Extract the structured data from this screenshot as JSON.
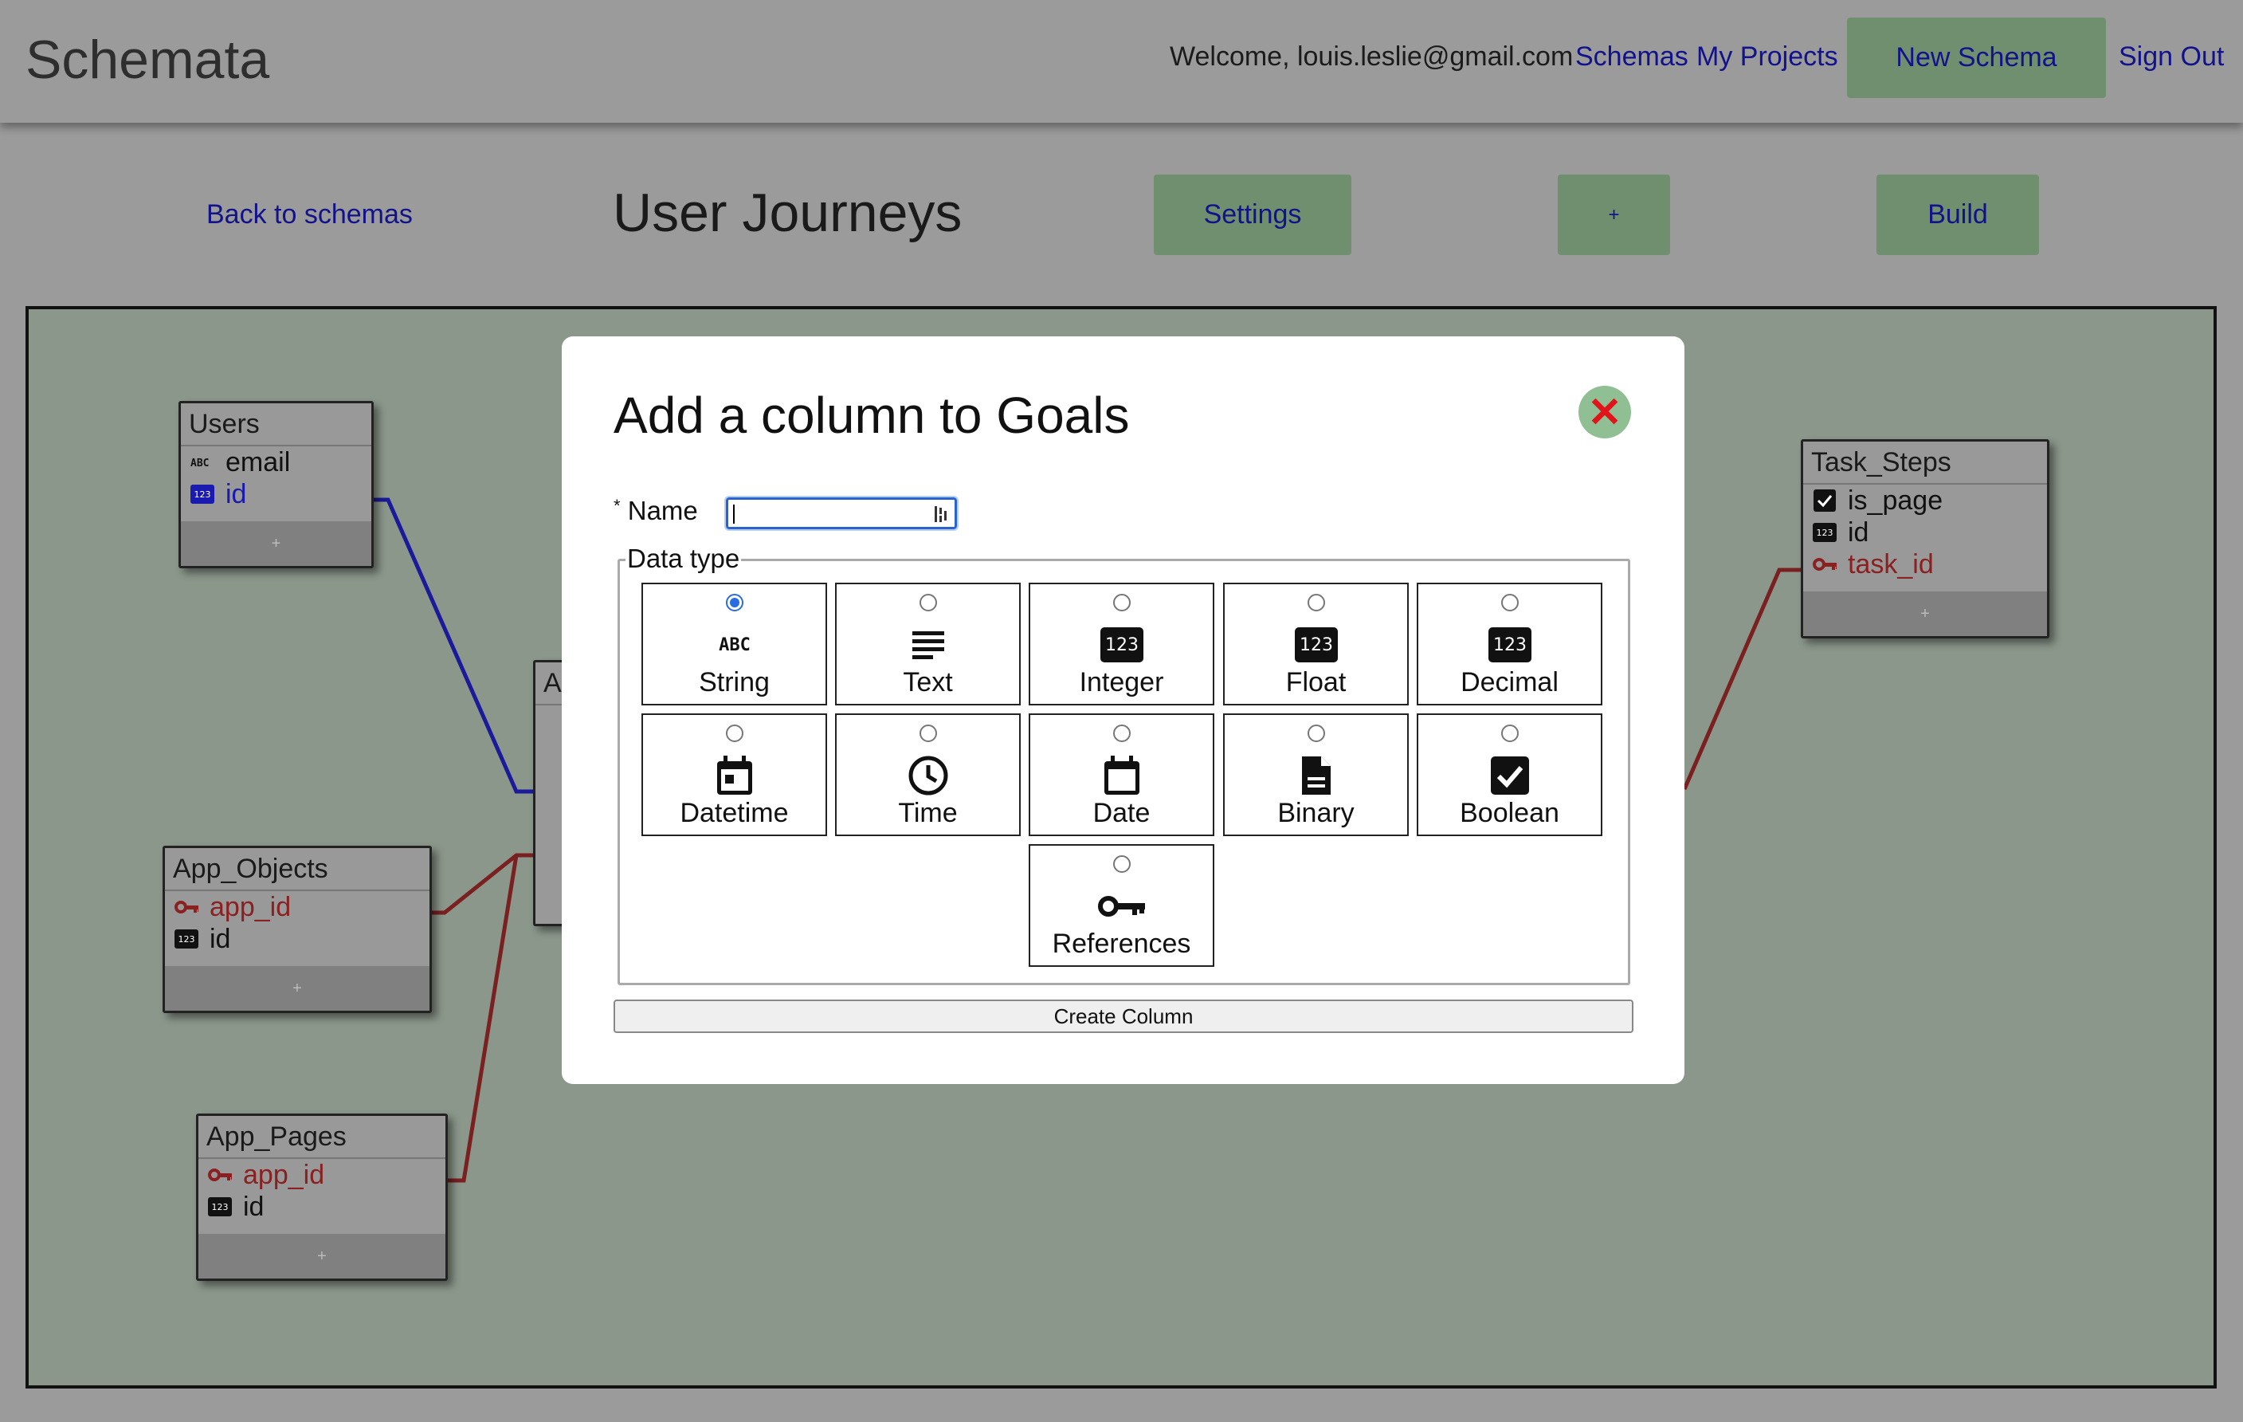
{
  "header": {
    "logo": "Schemata",
    "welcome": "Welcome, louis.leslie@gmail.com",
    "nav": {
      "schemas": "Schemas",
      "my_projects": "My Projects",
      "new_schema": "New Schema",
      "sign_out": "Sign Out"
    }
  },
  "subbar": {
    "back": "Back to schemas",
    "title": "User Journeys",
    "settings": "Settings",
    "plus": "+",
    "build": "Build"
  },
  "tables": {
    "users": {
      "name": "Users",
      "rows": [
        {
          "icon": "abc-icon",
          "label": "email"
        },
        {
          "icon": "number-icon",
          "label": "id"
        }
      ],
      "add": "+"
    },
    "app_partial": {
      "name": "A"
    },
    "app_objects": {
      "name": "App_Objects",
      "rows": [
        {
          "icon": "key-icon",
          "label": "app_id"
        },
        {
          "icon": "number-icon",
          "label": "id"
        }
      ],
      "add": "+"
    },
    "app_pages": {
      "name": "App_Pages",
      "rows": [
        {
          "icon": "key-icon",
          "label": "app_id"
        },
        {
          "icon": "number-icon",
          "label": "id"
        }
      ],
      "add": "+"
    },
    "task_steps": {
      "name": "Task_Steps",
      "rows": [
        {
          "icon": "checkbox-icon",
          "label": "is_page"
        },
        {
          "icon": "number-icon",
          "label": "id"
        },
        {
          "icon": "key-icon",
          "label": "task_id"
        }
      ],
      "add": "+"
    }
  },
  "modal": {
    "title": "Add a column to Goals",
    "name_required_marker": "*",
    "name_label": "Name",
    "name_value": "",
    "data_type_legend": "Data type",
    "options": [
      {
        "label": "String",
        "icon": "abc-icon",
        "selected": true
      },
      {
        "label": "Text",
        "icon": "text-lines-icon",
        "selected": false
      },
      {
        "label": "Integer",
        "icon": "number-icon",
        "selected": false
      },
      {
        "label": "Float",
        "icon": "number-icon",
        "selected": false
      },
      {
        "label": "Decimal",
        "icon": "number-icon",
        "selected": false
      },
      {
        "label": "Datetime",
        "icon": "calendar-event-icon",
        "selected": false
      },
      {
        "label": "Time",
        "icon": "clock-icon",
        "selected": false
      },
      {
        "label": "Date",
        "icon": "calendar-icon",
        "selected": false
      },
      {
        "label": "Binary",
        "icon": "file-icon",
        "selected": false
      },
      {
        "label": "Boolean",
        "icon": "checkbox-icon",
        "selected": false
      },
      {
        "label": "References",
        "icon": "key-icon",
        "selected": false
      }
    ],
    "create_button": "Create Column",
    "icon_text": {
      "abc": "ABC",
      "num": "123"
    }
  },
  "colors": {
    "accent_green": "#6f8f6f",
    "link_blue": "#12128a",
    "ref_red": "#8a2020",
    "id_blue": "#1a1ab0",
    "canvas": "#8b978b"
  }
}
